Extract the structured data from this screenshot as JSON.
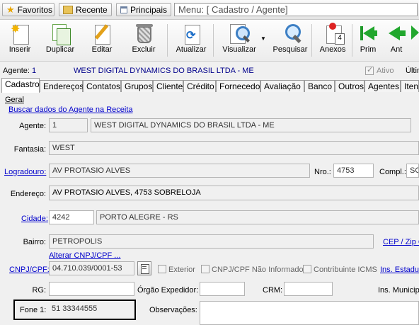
{
  "favbar": {
    "favoritos": "Favoritos",
    "recente": "Recente",
    "principais": "Principais",
    "menu_path": "Menu: [ Cadastro / Agente]"
  },
  "toolbar": {
    "inserir": "Inserir",
    "duplicar": "Duplicar",
    "editar": "Editar",
    "excluir": "Excluir",
    "atualizar": "Atualizar",
    "visualizar": "Visualizar",
    "pesquisar": "Pesquisar",
    "anexos": "Anexos",
    "anexos_count": "4",
    "prim": "Prim",
    "ant": "Ant"
  },
  "header": {
    "agente_label": "Agente:",
    "agente_id": "1",
    "agente_name": "WEST DIGITAL DYNAMICS DO BRASIL LTDA - ME",
    "ativo": "Ativo",
    "ultim": "Últim"
  },
  "tabs": [
    "Cadastro",
    "Endereços",
    "Contatos",
    "Grupos",
    "Cliente",
    "Crédito",
    "Fornecedor",
    "Avaliação",
    "Banco",
    "Outros",
    "Agentes",
    "Itens"
  ],
  "form": {
    "geral": "Geral",
    "buscar_link": "Buscar dados do Agente na Receita",
    "agente_label": "Agente:",
    "agente_code": "1",
    "agente_name": "WEST DIGITAL DYNAMICS DO BRASIL LTDA - ME",
    "fantasia_label": "Fantasia:",
    "fantasia_value": "WEST",
    "logradouro_label": "Logradouro:",
    "logradouro_value": "AV PROTASIO ALVES",
    "nro_label": "Nro.:",
    "nro_value": "4753",
    "compl_label": "Compl.:",
    "compl_value": "SO",
    "endereco_label": "Endereço:",
    "endereco_value": "AV PROTASIO ALVES, 4753 SOBRELOJA",
    "cidade_label": "Cidade:",
    "cidade_code": "4242",
    "cidade_name": "PORTO ALEGRE - RS",
    "bairro_label": "Bairro:",
    "bairro_value": "PETROPOLIS",
    "cep_link": "CEP / Zip C",
    "alterar_link": "Alterar CNPJ/CPF ...",
    "cnpj_label": "CNPJ/CPF:",
    "cnpj_value": "04.710.039/0001-53",
    "exterior": "Exterior",
    "cnpj_nao_informado": "CNPJ/CPF Não Informado",
    "contribuinte_icms": "Contribuinte ICMS",
    "ins_estadual_link": "Ins. Estadu",
    "rg_label": "RG:",
    "orgao_label": "Órgão Expedidor:",
    "crm_label": "CRM:",
    "ins_municipal_label": "Ins. Municipa",
    "fone1_label": "Fone 1:",
    "fone1_value": "51 33344555",
    "observacoes_label": "Observações:"
  }
}
